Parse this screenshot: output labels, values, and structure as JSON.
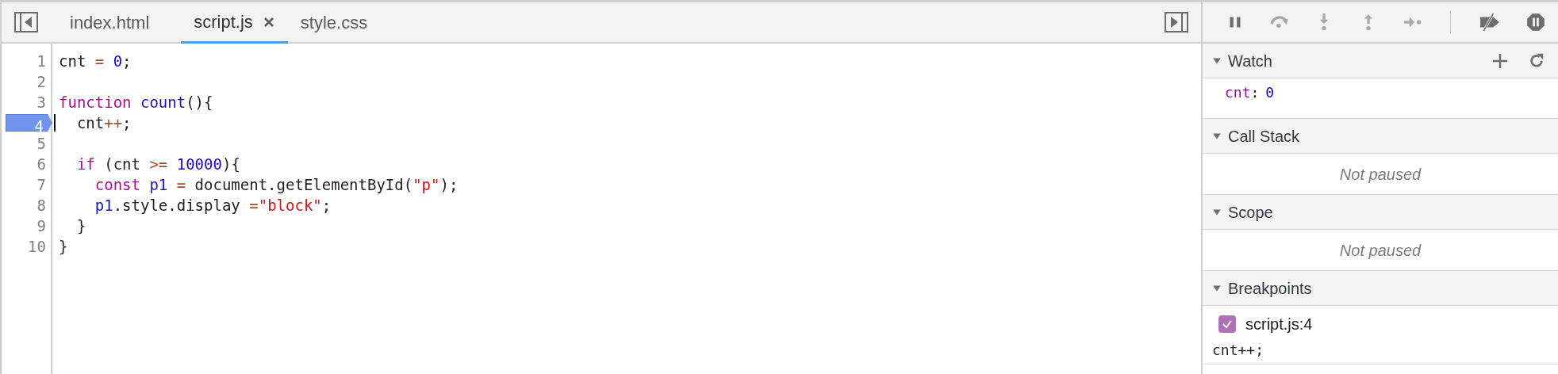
{
  "editor": {
    "tabs": [
      {
        "label": "index.html",
        "selected": false,
        "closable": false
      },
      {
        "label": "script.js",
        "selected": true,
        "closable": true
      },
      {
        "label": "style.css",
        "selected": false,
        "closable": false
      }
    ],
    "lines": [
      {
        "number": "1",
        "breakpoint": false,
        "cursor": false,
        "tokens": [
          {
            "kind": "plain",
            "text": "cnt "
          },
          {
            "kind": "operator",
            "text": "="
          },
          {
            "kind": "number",
            "text": " 0"
          },
          {
            "kind": "plain",
            "text": ";"
          }
        ]
      },
      {
        "number": "2",
        "breakpoint": false,
        "cursor": false
      },
      {
        "number": "3",
        "breakpoint": false,
        "cursor": false,
        "tokens": [
          {
            "kind": "keyword",
            "text": "function"
          },
          {
            "kind": "def",
            "text": " count"
          },
          {
            "kind": "plain",
            "text": "(){"
          }
        ]
      },
      {
        "number": "4",
        "breakpoint": true,
        "cursor": true,
        "tokens": [
          {
            "kind": "plain",
            "text": "  cnt"
          },
          {
            "kind": "operator",
            "text": "++"
          },
          {
            "kind": "plain",
            "text": ";"
          }
        ]
      },
      {
        "number": "5",
        "breakpoint": false,
        "cursor": false
      },
      {
        "number": "6",
        "breakpoint": false,
        "cursor": false,
        "tokens": [
          {
            "kind": "keyword",
            "text": "  if"
          },
          {
            "kind": "plain",
            "text": " (cnt "
          },
          {
            "kind": "operator",
            "text": ">="
          },
          {
            "kind": "number",
            "text": " 10000"
          },
          {
            "kind": "plain",
            "text": "){"
          }
        ]
      },
      {
        "number": "7",
        "breakpoint": false,
        "cursor": false,
        "tokens": [
          {
            "kind": "keyword",
            "text": "    const"
          },
          {
            "kind": "def",
            "text": " p1"
          },
          {
            "kind": "operator",
            "text": " ="
          },
          {
            "kind": "plain",
            "text": " document.getElementById("
          },
          {
            "kind": "string",
            "text": "\"p\""
          },
          {
            "kind": "plain",
            "text": ");"
          }
        ]
      },
      {
        "number": "8",
        "breakpoint": false,
        "cursor": false,
        "tokens": [
          {
            "kind": "def",
            "text": "    p1"
          },
          {
            "kind": "plain",
            "text": ".style.display "
          },
          {
            "kind": "operator",
            "text": "="
          },
          {
            "kind": "string",
            "text": "\"block\""
          },
          {
            "kind": "plain",
            "text": ";"
          }
        ]
      },
      {
        "number": "9",
        "breakpoint": false,
        "cursor": false,
        "tokens": [
          {
            "kind": "plain",
            "text": "  }"
          }
        ]
      },
      {
        "number": "10",
        "breakpoint": false,
        "cursor": false,
        "tokens": [
          {
            "kind": "plain",
            "text": "}"
          }
        ]
      }
    ]
  },
  "debugger": {
    "toolbar": [
      {
        "kind": "pause",
        "disabled": false
      },
      {
        "kind": "step-over",
        "disabled": true
      },
      {
        "kind": "step-into",
        "disabled": true
      },
      {
        "kind": "step-out",
        "disabled": true
      },
      {
        "kind": "step",
        "disabled": true
      },
      {
        "kind": "separator",
        "disabled": false
      },
      {
        "kind": "deactivate-breakpoints",
        "disabled": false
      },
      {
        "kind": "pause-on-exceptions",
        "disabled": false
      }
    ],
    "sections": [
      {
        "kind": "watch",
        "title": "Watch",
        "expanded": true,
        "watches": [
          {
            "name": "cnt",
            "separator": ":",
            "value": "0"
          }
        ]
      },
      {
        "kind": "message",
        "title": "Call Stack",
        "expanded": true,
        "message": "Not paused"
      },
      {
        "kind": "message",
        "title": "Scope",
        "expanded": true,
        "message": "Not paused"
      },
      {
        "kind": "breakpoints",
        "title": "Breakpoints",
        "expanded": true,
        "breakpoints": [
          {
            "label": "script.js:4",
            "checked": true,
            "code": "cnt++;"
          }
        ]
      }
    ]
  }
}
